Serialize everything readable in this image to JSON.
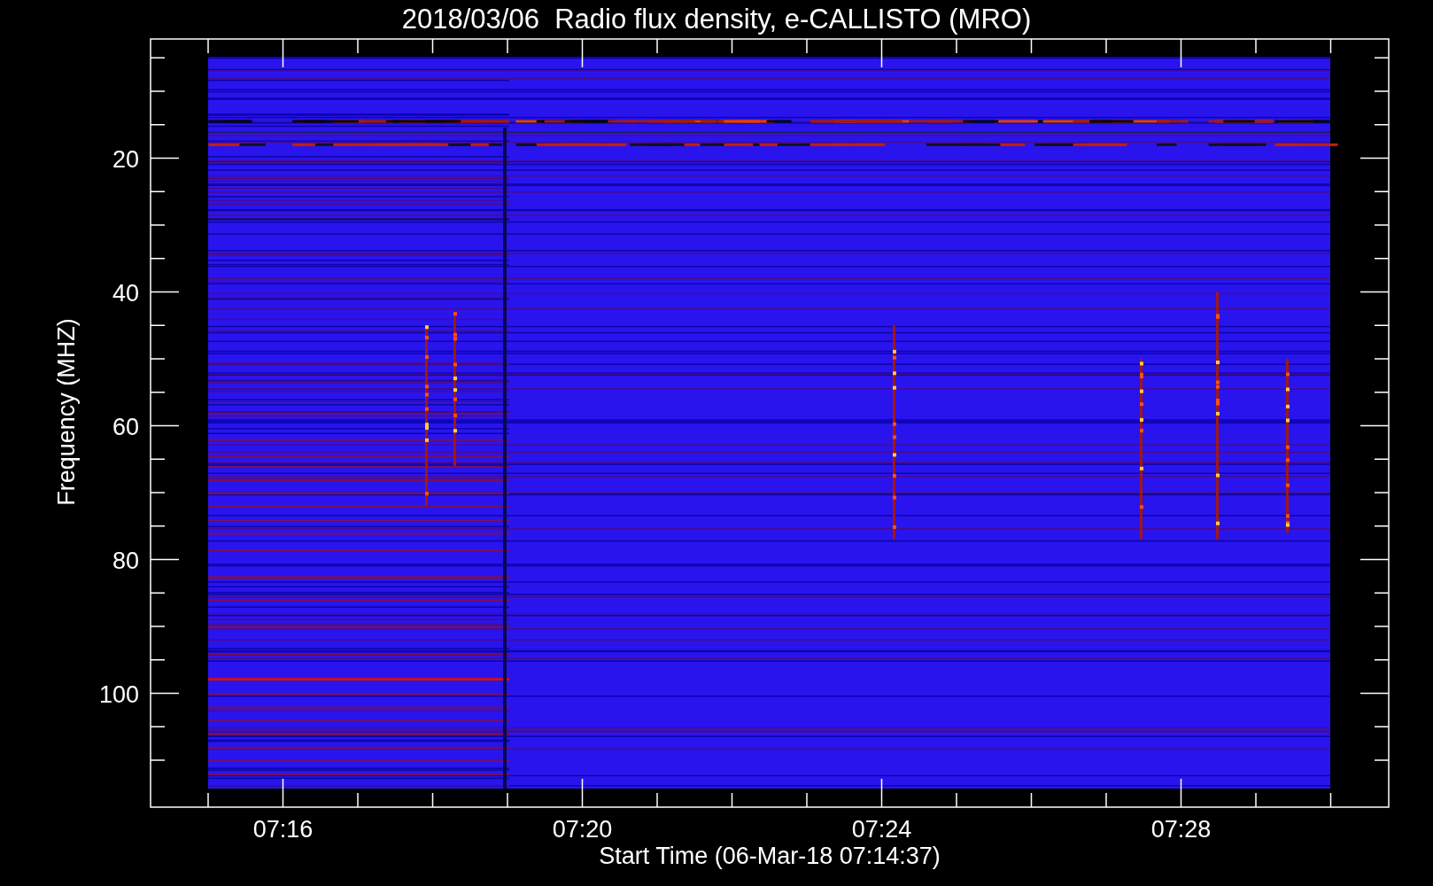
{
  "title": "2018/03/06  Radio flux density, e-CALLISTO (MRO)",
  "y_axis": {
    "label": "Frequency (MHZ)",
    "ticks": [
      "20",
      "40",
      "60",
      "80",
      "100"
    ]
  },
  "x_axis": {
    "label": "Start Time (06-Mar-18 07:14:37)",
    "ticks": [
      "07:16",
      "07:20",
      "07:24",
      "07:28"
    ]
  }
}
